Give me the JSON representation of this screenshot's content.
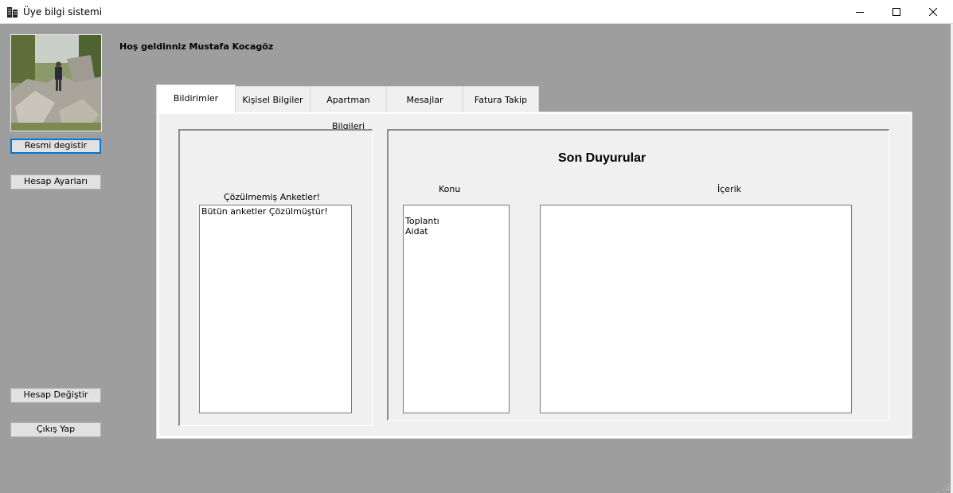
{
  "window": {
    "title": "Üye bilgi sistemi",
    "icon": "building-icon",
    "controls": [
      "minimize-icon",
      "maximize-icon",
      "close-icon"
    ]
  },
  "sidebar": {
    "change_photo_label": "Resmi degistir",
    "account_settings_label": "Hesap Ayarları",
    "switch_account_label": "Hesap Değiştir",
    "logout_label": "Çıkış Yap"
  },
  "welcome_text": "Hoş geldinniz Mustafa Kocagöz",
  "tabs": [
    {
      "label": "Bildirimler",
      "active": true
    },
    {
      "label": "Kişisel Bilgiler",
      "active": false
    },
    {
      "label": "Apartman Bilgileri",
      "active": false
    },
    {
      "label": "Mesajlar",
      "active": false
    },
    {
      "label": "Fatura Takip",
      "active": false
    }
  ],
  "surveys": {
    "label": "Çözülmemiş Anketler!",
    "items": [
      "Bütün anketler Çözülmüştür!"
    ]
  },
  "announcements": {
    "title": "Son Duyurular",
    "subject_label": "Konu",
    "content_label": "İçerik",
    "subjects": [
      "Toplantı",
      "Aidat"
    ]
  },
  "colors": {
    "client_bg": "#9e9e9e",
    "panel_bg": "#f0f0f0",
    "focus_border": "#0078d7"
  }
}
